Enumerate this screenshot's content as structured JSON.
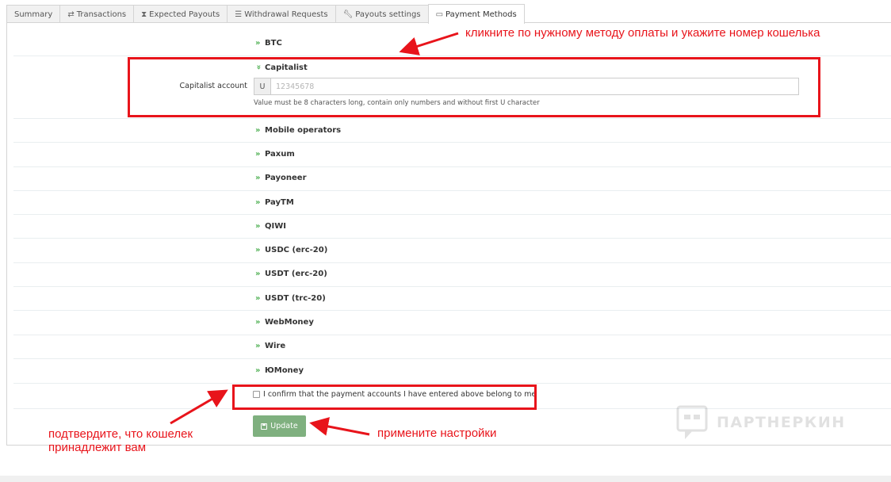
{
  "tabs": [
    {
      "label": "Summary",
      "icon": ""
    },
    {
      "label": "Transactions",
      "icon": "arrows-exchange-icon"
    },
    {
      "label": "Expected Payouts",
      "icon": "hourglass-icon"
    },
    {
      "label": "Withdrawal Requests",
      "icon": "list-icon"
    },
    {
      "label": "Payouts settings",
      "icon": "wrench-icon"
    },
    {
      "label": "Payment Methods",
      "icon": "credit-card-icon",
      "active": true
    }
  ],
  "methods": {
    "btc": "BTC",
    "capitalist": "Capitalist",
    "mobile": "Mobile operators",
    "paxum": "Paxum",
    "payoneer": "Payoneer",
    "paytm": "PayTM",
    "qiwi": "QIWI",
    "usdc_erc20": "USDC (erc-20)",
    "usdt_erc20": "USDT (erc-20)",
    "usdt_trc20": "USDT (trc-20)",
    "webmoney": "WebMoney",
    "wire": "Wire",
    "yumoney": "ЮMoney"
  },
  "capitalist_form": {
    "label": "Capitalist account",
    "prefix": "U",
    "placeholder": "12345678",
    "value": "",
    "help": "Value must be 8 characters long, contain only numbers and without first U character"
  },
  "confirm": {
    "label": "I confirm that the payment accounts I have entered above belong to me",
    "checked": false
  },
  "update_button": "Update",
  "annotations": {
    "top": "кликните по нужному методу оплаты и укажите номер кошелька",
    "bottom_left_line1": "подтвердите, что кошелек",
    "bottom_left_line2": "принадлежит вам",
    "bottom_right": "примените настройки"
  },
  "watermark": "ПАРТНЕРКИН",
  "colors": {
    "annotation_red": "#e8141b",
    "chevron_green": "#4caf50",
    "button_green": "#7fb07f"
  }
}
